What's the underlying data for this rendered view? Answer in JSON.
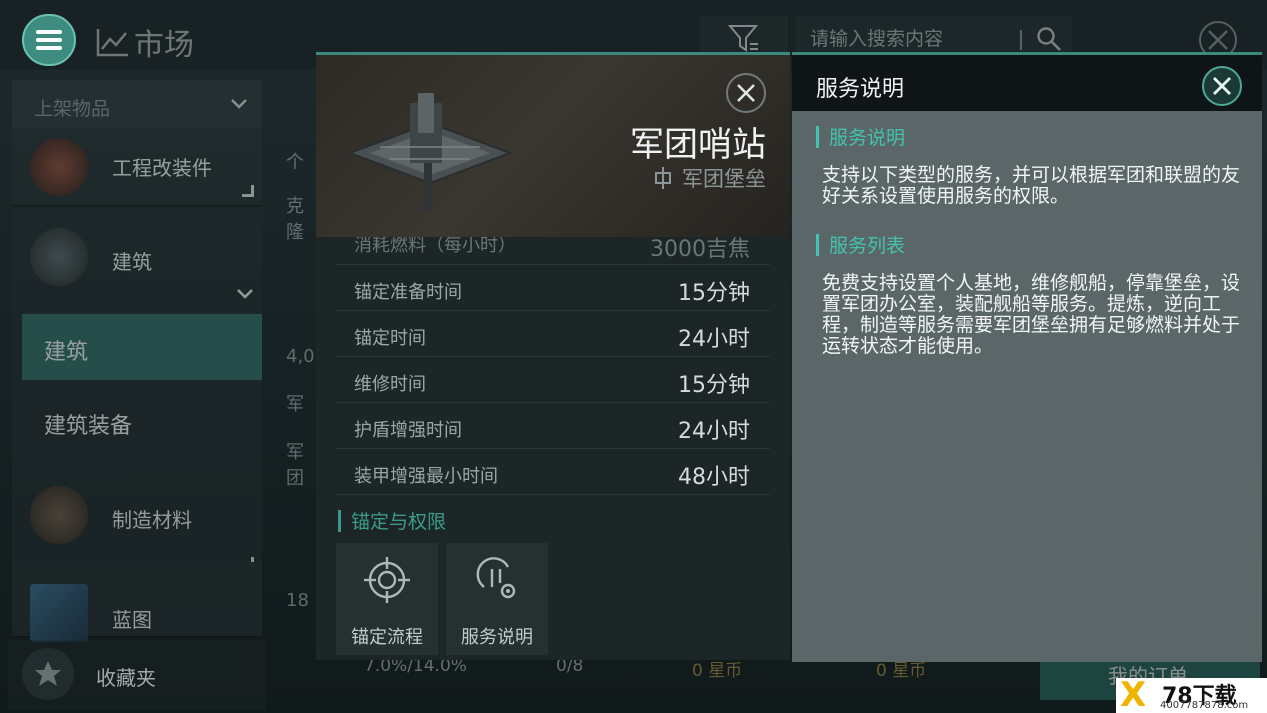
{
  "topbar": {
    "title": "市场",
    "search_placeholder": "请输入搜索内容"
  },
  "sidebar": {
    "category_header": "上架物品",
    "items": [
      {
        "label": "工程改装件"
      },
      {
        "label": "建筑"
      },
      {
        "label": "制造材料"
      },
      {
        "label": "蓝图"
      }
    ],
    "sub_items": [
      {
        "label": "建筑",
        "active": true
      },
      {
        "label": "建筑装备",
        "active": false
      }
    ],
    "favorites": "收藏夹"
  },
  "background_list": {
    "hints": [
      "个",
      "克隆",
      "4,0",
      "军",
      "军团",
      "18"
    ]
  },
  "bottom_bar": {
    "tax": "7.0%/14.0%",
    "orders": "0/8",
    "buy_total": "0 星币",
    "sell_total": "0 星币",
    "my_orders": "我的订单"
  },
  "detail": {
    "name": "军团哨站",
    "type": "军团堡垒",
    "partial_row": {
      "key": "消耗燃料（每小时）",
      "value": "3000吉焦"
    },
    "stats": [
      {
        "key": "锚定准备时间",
        "value": "15分钟"
      },
      {
        "key": "锚定时间",
        "value": "24小时"
      },
      {
        "key": "维修时间",
        "value": "15分钟"
      },
      {
        "key": "护盾增强时间",
        "value": "24小时"
      },
      {
        "key": "装甲增强最小时间",
        "value": "48小时"
      }
    ],
    "section_title": "锚定与权限",
    "actions": [
      {
        "label": "锚定流程",
        "icon": "crosshair-icon"
      },
      {
        "label": "服务说明",
        "icon": "service-gear-icon"
      }
    ]
  },
  "info_panel": {
    "title": "服务说明",
    "sections": [
      {
        "heading": "服务说明",
        "text": "支持以下类型的服务，并可以根据军团和联盟的友好关系设置使用服务的权限。"
      },
      {
        "heading": "服务列表",
        "text": "免费支持设置个人基地，维修舰船，停靠堡垒，设置军团办公室，装配舰船等服务。提炼，逆向工程，制造等服务需要军团堡垒拥有足够燃料并处于运转状态才能使用。"
      }
    ]
  },
  "watermark": {
    "logo": "X",
    "brand": "78下载",
    "url": "4007787878.com"
  },
  "colors": {
    "accent": "#3c9a8b",
    "accent_bright": "#43c3ad",
    "active_tab": "#2f6a63"
  }
}
